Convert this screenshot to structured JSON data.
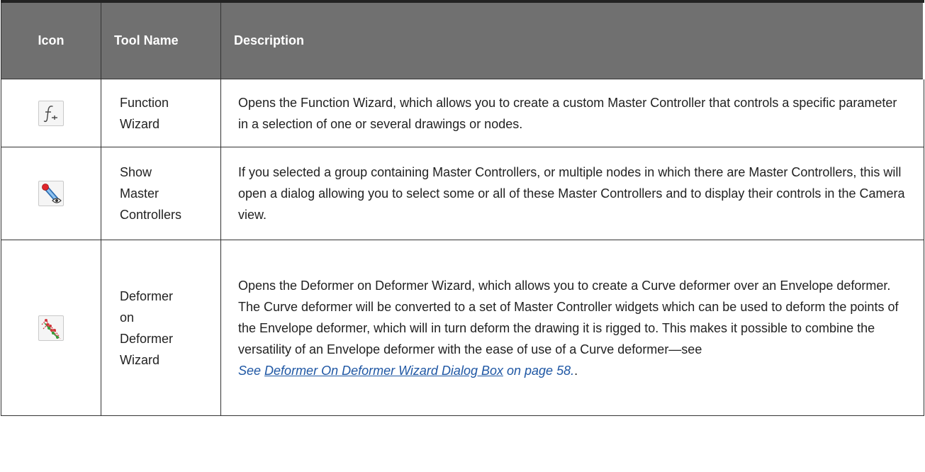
{
  "header": {
    "icon": "Icon",
    "tool_name": "Tool Name",
    "description": "Description"
  },
  "rows": [
    {
      "icon": "function-wizard-icon",
      "name_lines": [
        "Function",
        "Wizard"
      ],
      "description": "Opens the Function Wizard, which allows you to create a custom Master Controller that controls a specific parameter in a selection of one or several drawings or nodes."
    },
    {
      "icon": "show-master-controllers-icon",
      "name_lines": [
        "Show",
        "Master",
        "Controllers"
      ],
      "description": "If you selected a group containing Master Controllers, or multiple nodes in which there are Master Controllers, this will open a dialog allowing you to select some or all of these Master Controllers and to display their controls in the Camera view."
    },
    {
      "icon": "deformer-on-deformer-wizard-icon",
      "name_lines": [
        "Deformer",
        "on",
        "Deformer",
        "Wizard"
      ],
      "description": "Opens the Deformer on Deformer Wizard, which allows you to create a Curve deformer over an Envelope deformer. The Curve deformer will be converted to a set of Master Controller widgets which can be used to deform the points of the Envelope deformer, which will in turn deform the drawing it is rigged to. This makes it possible to combine the versatility of an Envelope deformer with the ease of use of a Curve deformer—see",
      "see_prefix": "See",
      "link_text": "Deformer On Deformer Wizard Dialog Box",
      "page_ref": "on page 58.",
      "trailing": "."
    }
  ]
}
